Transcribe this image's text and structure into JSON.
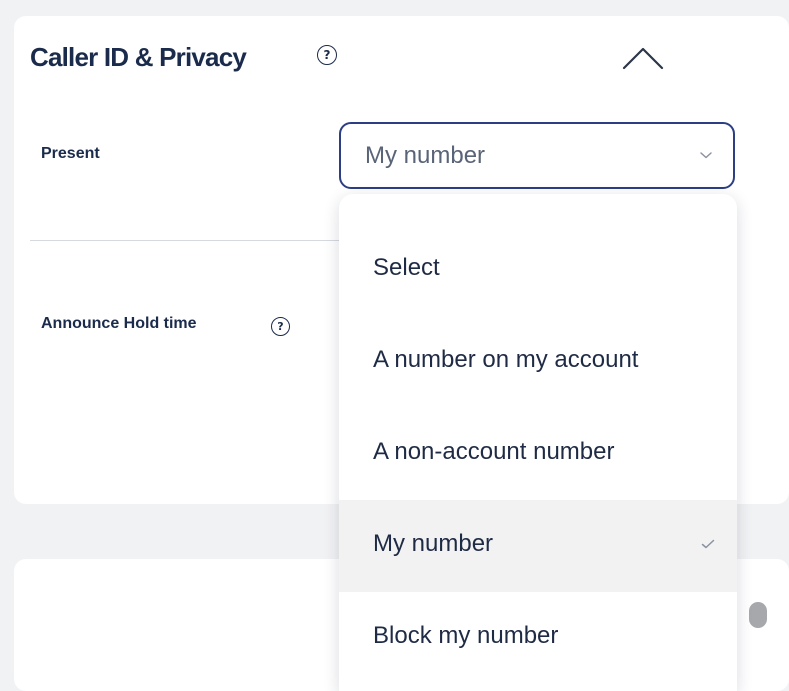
{
  "section": {
    "title": "Caller ID & Privacy",
    "help_glyph": "?"
  },
  "present": {
    "label": "Present",
    "selected_value": "My number"
  },
  "announce_hold": {
    "label": "Announce Hold time",
    "help_glyph": "?"
  },
  "dropdown": {
    "options": [
      {
        "label": "Select",
        "selected": false
      },
      {
        "label": "A number on my account",
        "selected": false
      },
      {
        "label": "A non-account number",
        "selected": false
      },
      {
        "label": "My number",
        "selected": true
      },
      {
        "label": "Block my number",
        "selected": false
      }
    ]
  },
  "icons": {
    "collapse": "chevron-up-icon",
    "select_arrow": "chevron-down-icon",
    "selected_mark": "checkmark-icon",
    "help": "question-circle-icon"
  },
  "colors": {
    "background": "#f1f2f4",
    "card": "#ffffff",
    "text_primary": "#1b2b4b",
    "select_border": "#2c3e84",
    "selected_option_bg": "#f2f2f3",
    "toggle": "#a7a8ab"
  }
}
